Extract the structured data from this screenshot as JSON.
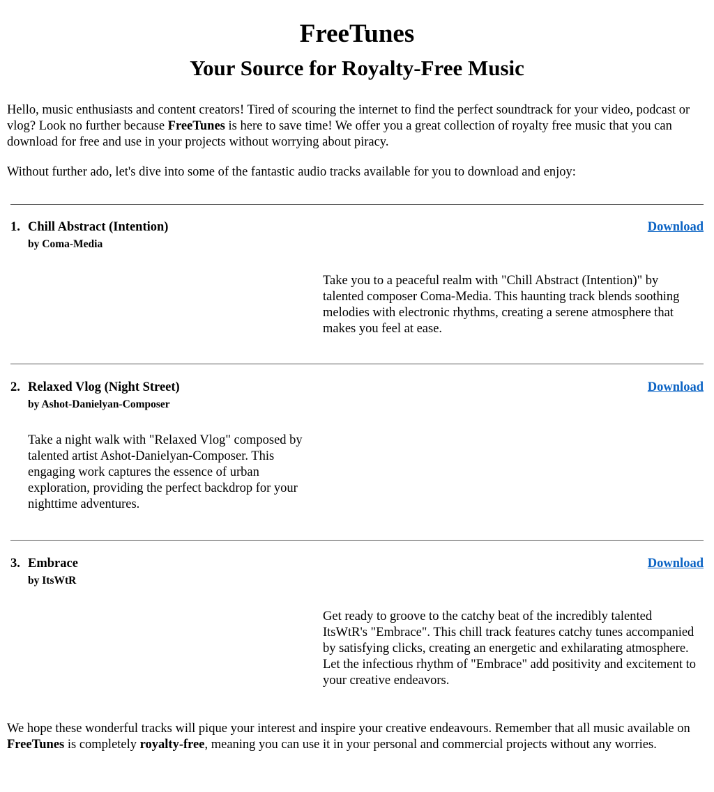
{
  "header": {
    "title": "FreeTunes",
    "subtitle": "Your Source for Royalty-Free Music"
  },
  "intro": {
    "p1_before": "Hello, music enthusiasts and content creators! Tired of scouring the internet to find the perfect soundtrack for your video, podcast or vlog? Look no further because ",
    "p1_brand": "FreeTunes",
    "p1_after": " is here to save time! We offer you a great collection of royalty free music that you can download for free and use in your projects without worrying about piracy.",
    "p2": "Without further ado, let's dive into some of the fantastic audio tracks available for you to download and enjoy:"
  },
  "tracks": [
    {
      "number": "1.",
      "title": "Chill Abstract (Intention)",
      "artist": "by Coma-Media",
      "download_label": "Download",
      "description": "Take you to a peaceful realm with \"Chill Abstract (Intention)\" by talented composer Coma-Media. This haunting track blends soothing melodies with electronic rhythms, creating a serene atmosphere that makes you feel at ease."
    },
    {
      "number": "2.",
      "title": "Relaxed Vlog (Night Street)",
      "artist": "by Ashot-Danielyan-Composer",
      "download_label": "Download",
      "description": "Take a night walk with \"Relaxed Vlog\" composed by talented artist Ashot-Danielyan-Composer. This engaging work captures the essence of urban exploration, providing the perfect backdrop for your nighttime adventures."
    },
    {
      "number": "3.",
      "title": "Embrace",
      "artist": "by ItsWtR",
      "download_label": "Download",
      "description": "Get ready to groove to the catchy beat of the incredibly talented ItsWtR's \"Embrace\". This chill track features catchy tunes accompanied by satisfying clicks, creating an energetic and exhilarating atmosphere. Let the infectious rhythm of \"Embrace\" add positivity and excitement to your creative endeavors."
    }
  ],
  "outro": {
    "before": "We hope these wonderful tracks will pique your interest and inspire your creative endeavours. Remember that all music available on ",
    "brand": "FreeTunes",
    "middle": " is completely ",
    "emphasis": "royalty-free",
    "after": ", meaning you can use it in your personal and commercial projects without any worries."
  },
  "colors": {
    "link": "#0b63c4",
    "divider": "#555555",
    "background": "#ffffff",
    "text": "#000000"
  }
}
